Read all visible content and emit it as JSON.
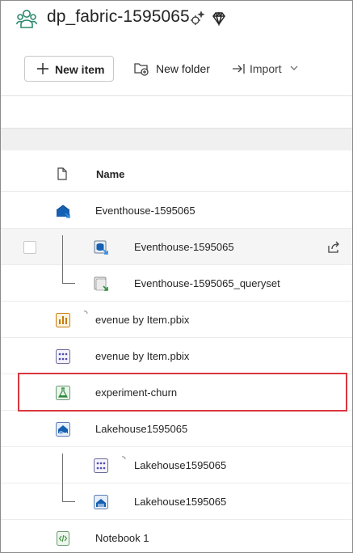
{
  "workspace": {
    "title": "dp_fabric-1595065",
    "icons": [
      "workspace-people-icon",
      "settings-spark-icon",
      "premium-diamond-icon"
    ]
  },
  "toolbar": {
    "new_item_label": "New item",
    "new_folder_label": "New folder",
    "import_label": "Import"
  },
  "table": {
    "name_header": "Name",
    "rows": [
      {
        "label": "Eventhouse-1595065",
        "icon": "eventhouse-icon"
      },
      {
        "label": "Eventhouse-1595065",
        "icon": "kql-database-icon"
      },
      {
        "label": "Eventhouse-1595065_queryset",
        "icon": "kql-queryset-icon"
      },
      {
        "label": "evenue by Item.pbix",
        "icon": "report-icon"
      },
      {
        "label": "evenue by Item.pbix",
        "icon": "semantic-model-icon"
      },
      {
        "label": "experiment-churn",
        "icon": "experiment-flask-icon"
      },
      {
        "label": "Lakehouse1595065",
        "icon": "lakehouse-icon"
      },
      {
        "label": "Lakehouse1595065",
        "icon": "semantic-model-icon"
      },
      {
        "label": "Lakehouse1595065",
        "icon": "sql-endpoint-icon"
      },
      {
        "label": "Notebook 1",
        "icon": "notebook-icon"
      }
    ]
  },
  "colors": {
    "highlight": "#d9363e",
    "eventhouse_blue": "#1560b3",
    "report_amber": "#c57c0a",
    "experiment_green": "#2c8a3c",
    "notebook_green": "#3a8f3a"
  }
}
